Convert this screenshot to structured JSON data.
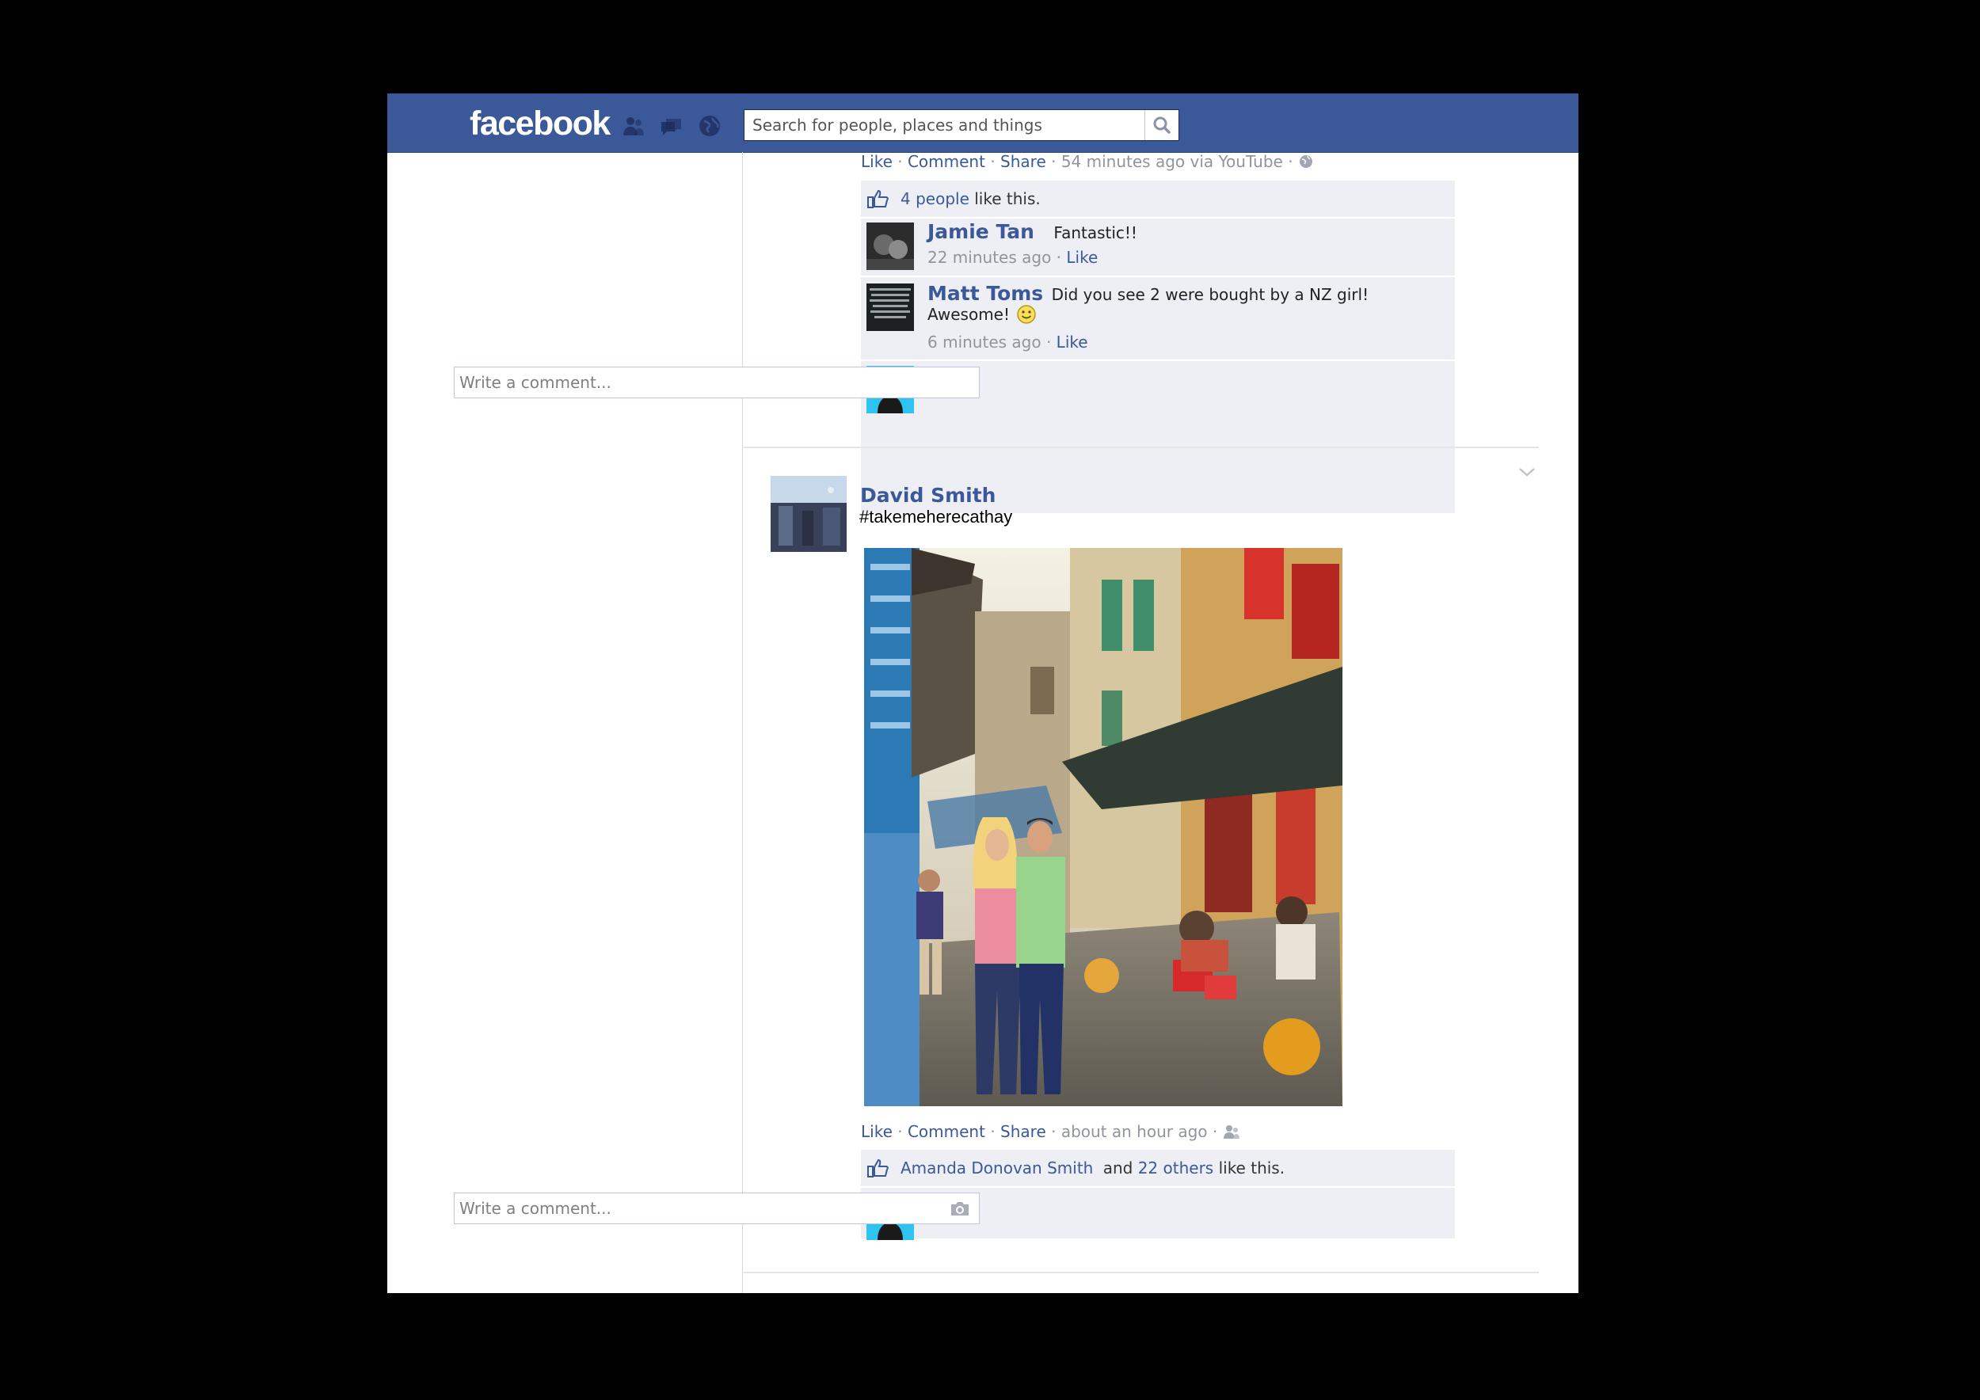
{
  "app": {
    "logo": "facebook"
  },
  "search": {
    "placeholder": "Search for people, places and things"
  },
  "prev_story": {
    "actions": {
      "like": "Like",
      "comment": "Comment",
      "share": "Share",
      "meta": "54 minutes ago via YouTube"
    },
    "likes": {
      "link": "4 people",
      "suffix": "like this."
    },
    "comments": [
      {
        "name": "Jamie Tan",
        "text": "Fantastic!!",
        "time": "22 minutes ago",
        "like": "Like"
      },
      {
        "name": "Matt Toms",
        "text": "Did you see 2 were bought by a NZ girl!",
        "text2": "Awesome!",
        "time": "6 minutes ago",
        "like": "Like"
      }
    ],
    "write_placeholder": "Write a comment..."
  },
  "post": {
    "author": "David Smith",
    "text": "#takemeherecathay",
    "actions": {
      "like": "Like",
      "comment": "Comment",
      "share": "Share",
      "meta": "about an hour ago"
    },
    "likes": {
      "name": "Amanda Donovan Smith",
      "and": "and",
      "others": "22 others",
      "suffix": "like this."
    },
    "write_placeholder": "Write a comment..."
  },
  "icons": {
    "friends": "friends-icon",
    "messages": "messages-icon",
    "notifications": "globe-icon",
    "search": "search-icon",
    "like": "thumbs-up-icon",
    "privacy_public": "globe-icon",
    "privacy_friends": "friends-icon",
    "camera": "camera-icon",
    "menu": "chevron-down-icon",
    "smiley": "smiley-icon"
  },
  "colors": {
    "brand": "#3b5998",
    "link": "#3b5998",
    "ufi_bg": "#edeff4",
    "meta": "#90949c"
  }
}
